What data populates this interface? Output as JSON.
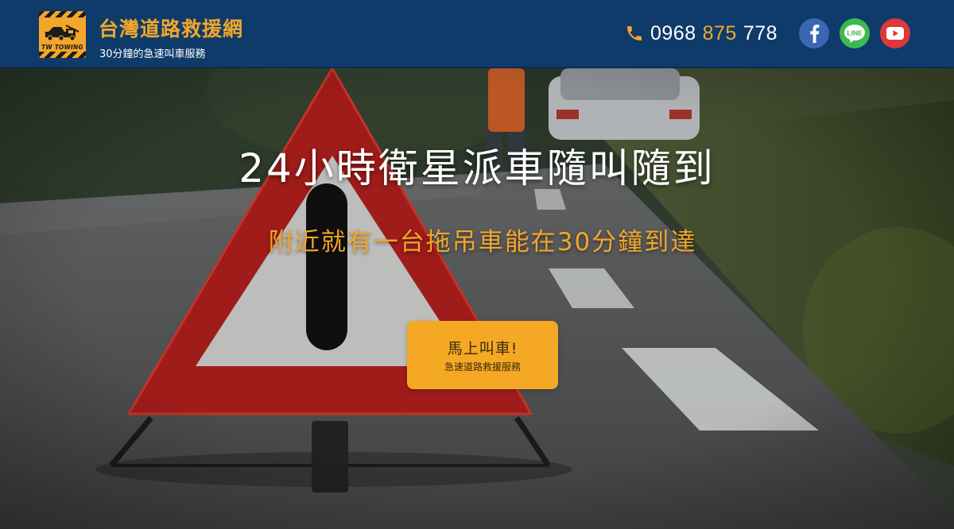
{
  "header": {
    "logo_text": "TW TOWING",
    "brand_title": "台灣道路救援網",
    "brand_subtitle": "30分鐘的急速叫車服務",
    "phone_parts": [
      "0968",
      "875",
      "778"
    ],
    "accent_color": "#f2a62a",
    "background_color": "#0f3b6b",
    "social": [
      {
        "name": "facebook",
        "icon": "facebook-icon",
        "color": "#3b66b0"
      },
      {
        "name": "line",
        "icon": "line-icon",
        "label": "LINE",
        "color": "#3cb950"
      },
      {
        "name": "youtube",
        "icon": "youtube-icon",
        "color": "#e0373a"
      }
    ]
  },
  "hero": {
    "title": "24小時衛星派車隨叫隨到",
    "subtitle": "附近就有一台拖吊車能在30分鐘到達",
    "cta": {
      "label": "馬上叫車!",
      "sublabel": "急速道路救援服務",
      "color": "#f5a823"
    }
  }
}
